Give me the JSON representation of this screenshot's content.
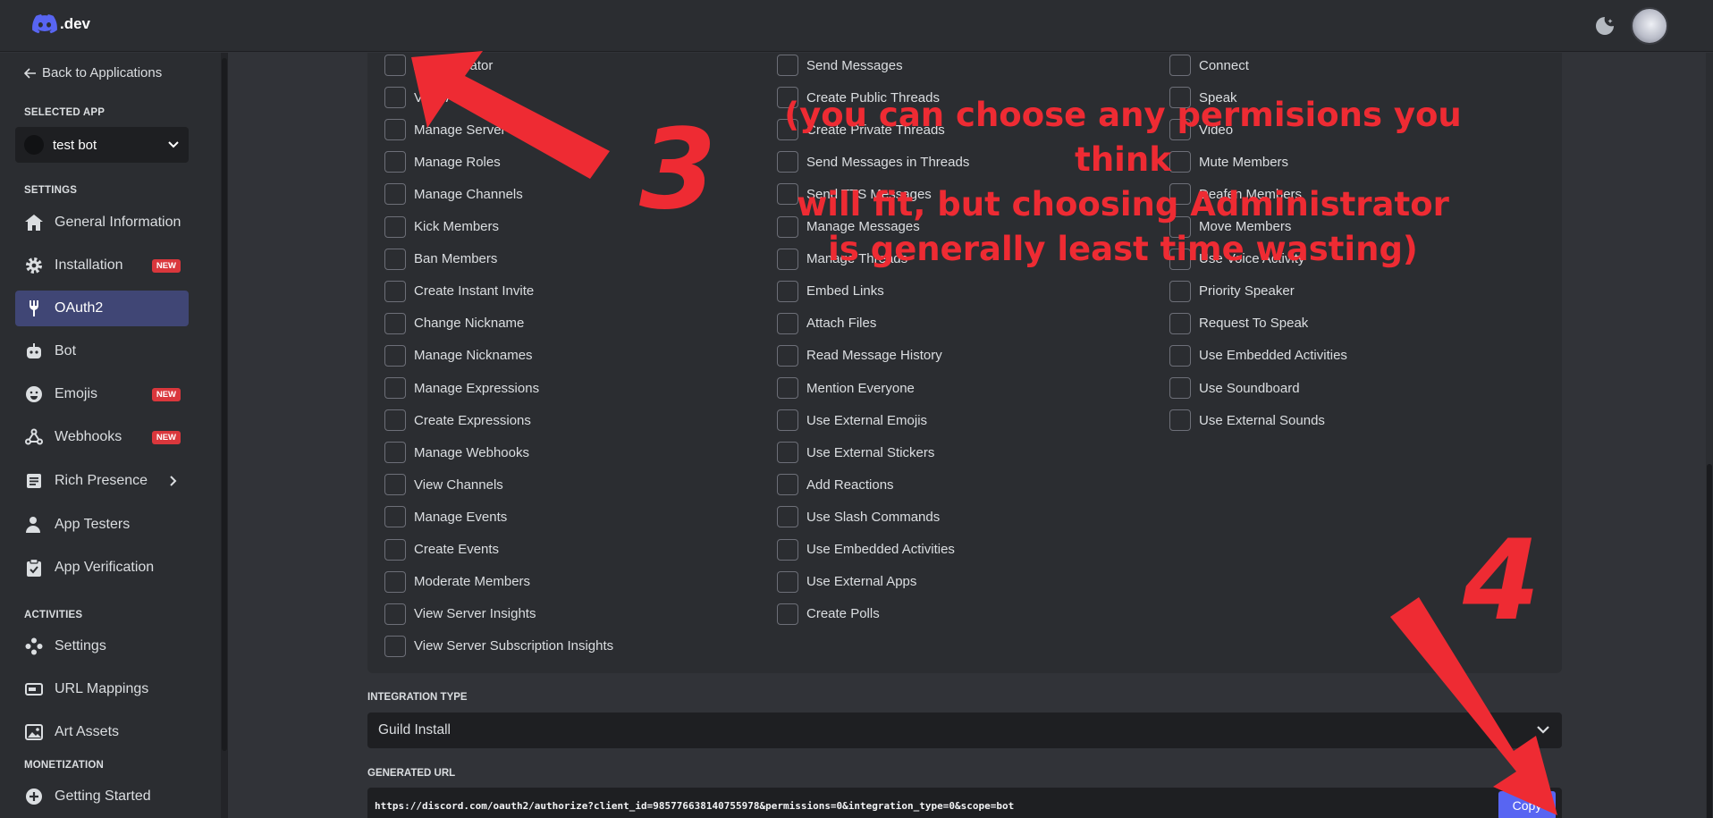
{
  "brand": {
    "logo_text": ".dev"
  },
  "sidebar": {
    "back_label": "Back to Applications",
    "selected_app_heading": "SELECTED APP",
    "selected_app": "test bot",
    "settings_heading": "SETTINGS",
    "settings_items": [
      {
        "label": "General Information",
        "icon": "home-icon"
      },
      {
        "label": "Installation",
        "icon": "gear-icon",
        "badge": "NEW"
      },
      {
        "label": "OAuth2",
        "icon": "wrench-icon",
        "active": true
      },
      {
        "label": "Bot",
        "icon": "robot-icon"
      },
      {
        "label": "Emojis",
        "icon": "emoji-icon",
        "badge": "NEW"
      },
      {
        "label": "Webhooks",
        "icon": "webhook-icon",
        "badge": "NEW"
      },
      {
        "label": "Rich Presence",
        "icon": "document-icon"
      },
      {
        "label": "App Testers",
        "icon": "user-icon"
      },
      {
        "label": "App Verification",
        "icon": "clipboard-check-icon"
      }
    ],
    "activities_heading": "ACTIVITIES",
    "activities_items": [
      {
        "label": "Settings",
        "icon": "gamepad-icon"
      },
      {
        "label": "URL Mappings",
        "icon": "link-icon"
      },
      {
        "label": "Art Assets",
        "icon": "image-icon"
      }
    ],
    "monetization_heading": "MONETIZATION",
    "monetization_items": [
      {
        "label": "Getting Started",
        "icon": "plus-circle-icon"
      }
    ]
  },
  "permissions": {
    "column1": [
      "Administrator",
      "View Audit Log",
      "Manage Server",
      "Manage Roles",
      "Manage Channels",
      "Kick Members",
      "Ban Members",
      "Create Instant Invite",
      "Change Nickname",
      "Manage Nicknames",
      "Manage Expressions",
      "Create Expressions",
      "Manage Webhooks",
      "View Channels",
      "Manage Events",
      "Create Events",
      "Moderate Members",
      "View Server Insights",
      "View Server Subscription Insights"
    ],
    "column2": [
      "Send Messages",
      "Create Public Threads",
      "Create Private Threads",
      "Send Messages in Threads",
      "Send TTS Messages",
      "Manage Messages",
      "Manage Threads",
      "Embed Links",
      "Attach Files",
      "Read Message History",
      "Mention Everyone",
      "Use External Emojis",
      "Use External Stickers",
      "Add Reactions",
      "Use Slash Commands",
      "Use Embedded Activities",
      "Use External Apps",
      "Create Polls"
    ],
    "column3": [
      "Connect",
      "Speak",
      "Video",
      "Mute Members",
      "Deafen Members",
      "Move Members",
      "Use Voice Activity",
      "Priority Speaker",
      "Request To Speak",
      "Use Embedded Activities",
      "Use Soundboard",
      "Use External Sounds"
    ]
  },
  "integration": {
    "label": "INTEGRATION TYPE",
    "value": "Guild Install"
  },
  "generated_url": {
    "label": "GENERATED URL",
    "url": "https://discord.com/oauth2/authorize?client_id=985776638140755978&permissions=0&integration_type=0&scope=bot",
    "copy_label": "Copy"
  },
  "annotations": {
    "step3": "3",
    "step4": "4",
    "note_lines": [
      "(you can choose any permisions you think",
      "will fit, but choosing Administrator",
      "is generally least time wasting)"
    ]
  },
  "colors": {
    "accent": "#5865f2",
    "annotation_red": "#ee2b33",
    "badge_red": "#da373c",
    "active_nav": "#404675"
  }
}
